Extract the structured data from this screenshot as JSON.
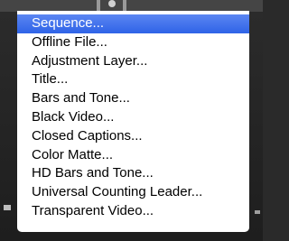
{
  "menu": {
    "highlighted_index": 0,
    "highlight_color": "#3a6ceb",
    "items": [
      {
        "label": "Sequence..."
      },
      {
        "label": "Offline File..."
      },
      {
        "label": "Adjustment Layer..."
      },
      {
        "label": "Title..."
      },
      {
        "label": "Bars and Tone..."
      },
      {
        "label": "Black Video..."
      },
      {
        "label": "Closed Captions..."
      },
      {
        "label": "Color Matte..."
      },
      {
        "label": "HD Bars and Tone..."
      },
      {
        "label": "Universal Counting Leader..."
      },
      {
        "label": "Transparent Video..."
      }
    ]
  }
}
